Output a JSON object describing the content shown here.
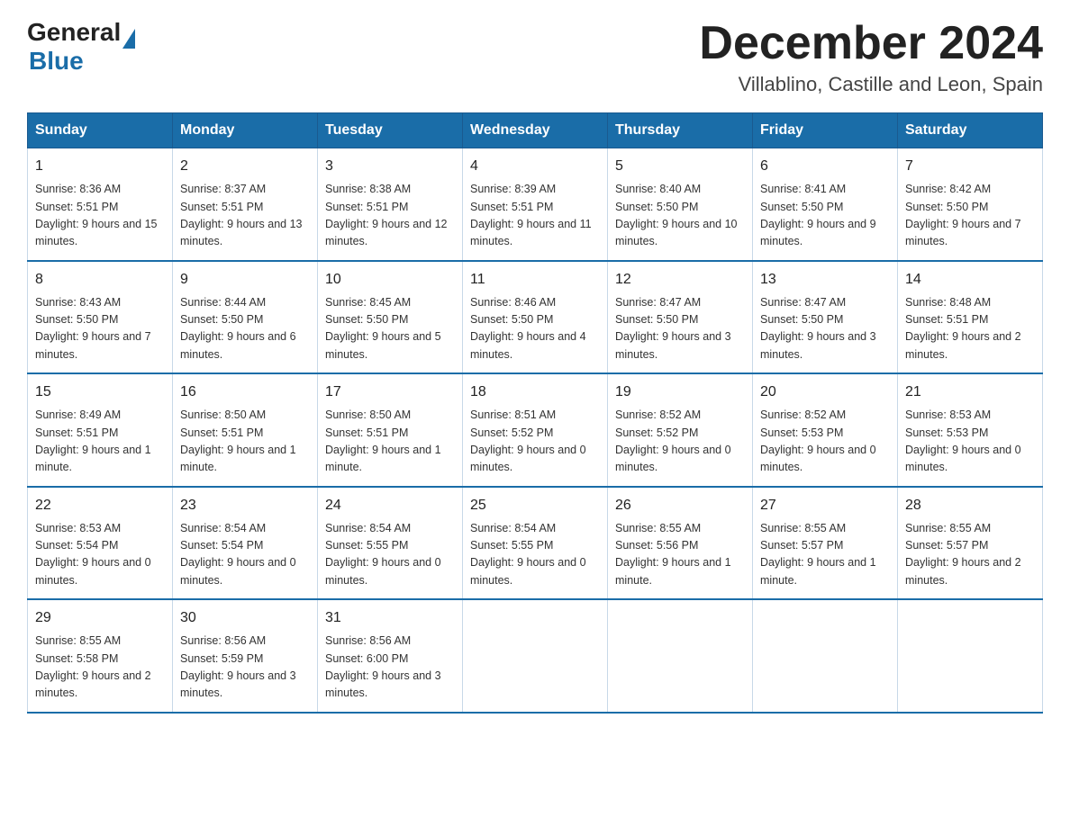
{
  "header": {
    "logo_general": "General",
    "logo_blue": "Blue",
    "title": "December 2024",
    "subtitle": "Villablino, Castille and Leon, Spain"
  },
  "calendar": {
    "days_of_week": [
      "Sunday",
      "Monday",
      "Tuesday",
      "Wednesday",
      "Thursday",
      "Friday",
      "Saturday"
    ],
    "weeks": [
      [
        {
          "day": "1",
          "sunrise": "8:36 AM",
          "sunset": "5:51 PM",
          "daylight": "9 hours and 15 minutes."
        },
        {
          "day": "2",
          "sunrise": "8:37 AM",
          "sunset": "5:51 PM",
          "daylight": "9 hours and 13 minutes."
        },
        {
          "day": "3",
          "sunrise": "8:38 AM",
          "sunset": "5:51 PM",
          "daylight": "9 hours and 12 minutes."
        },
        {
          "day": "4",
          "sunrise": "8:39 AM",
          "sunset": "5:51 PM",
          "daylight": "9 hours and 11 minutes."
        },
        {
          "day": "5",
          "sunrise": "8:40 AM",
          "sunset": "5:50 PM",
          "daylight": "9 hours and 10 minutes."
        },
        {
          "day": "6",
          "sunrise": "8:41 AM",
          "sunset": "5:50 PM",
          "daylight": "9 hours and 9 minutes."
        },
        {
          "day": "7",
          "sunrise": "8:42 AM",
          "sunset": "5:50 PM",
          "daylight": "9 hours and 7 minutes."
        }
      ],
      [
        {
          "day": "8",
          "sunrise": "8:43 AM",
          "sunset": "5:50 PM",
          "daylight": "9 hours and 7 minutes."
        },
        {
          "day": "9",
          "sunrise": "8:44 AM",
          "sunset": "5:50 PM",
          "daylight": "9 hours and 6 minutes."
        },
        {
          "day": "10",
          "sunrise": "8:45 AM",
          "sunset": "5:50 PM",
          "daylight": "9 hours and 5 minutes."
        },
        {
          "day": "11",
          "sunrise": "8:46 AM",
          "sunset": "5:50 PM",
          "daylight": "9 hours and 4 minutes."
        },
        {
          "day": "12",
          "sunrise": "8:47 AM",
          "sunset": "5:50 PM",
          "daylight": "9 hours and 3 minutes."
        },
        {
          "day": "13",
          "sunrise": "8:47 AM",
          "sunset": "5:50 PM",
          "daylight": "9 hours and 3 minutes."
        },
        {
          "day": "14",
          "sunrise": "8:48 AM",
          "sunset": "5:51 PM",
          "daylight": "9 hours and 2 minutes."
        }
      ],
      [
        {
          "day": "15",
          "sunrise": "8:49 AM",
          "sunset": "5:51 PM",
          "daylight": "9 hours and 1 minute."
        },
        {
          "day": "16",
          "sunrise": "8:50 AM",
          "sunset": "5:51 PM",
          "daylight": "9 hours and 1 minute."
        },
        {
          "day": "17",
          "sunrise": "8:50 AM",
          "sunset": "5:51 PM",
          "daylight": "9 hours and 1 minute."
        },
        {
          "day": "18",
          "sunrise": "8:51 AM",
          "sunset": "5:52 PM",
          "daylight": "9 hours and 0 minutes."
        },
        {
          "day": "19",
          "sunrise": "8:52 AM",
          "sunset": "5:52 PM",
          "daylight": "9 hours and 0 minutes."
        },
        {
          "day": "20",
          "sunrise": "8:52 AM",
          "sunset": "5:53 PM",
          "daylight": "9 hours and 0 minutes."
        },
        {
          "day": "21",
          "sunrise": "8:53 AM",
          "sunset": "5:53 PM",
          "daylight": "9 hours and 0 minutes."
        }
      ],
      [
        {
          "day": "22",
          "sunrise": "8:53 AM",
          "sunset": "5:54 PM",
          "daylight": "9 hours and 0 minutes."
        },
        {
          "day": "23",
          "sunrise": "8:54 AM",
          "sunset": "5:54 PM",
          "daylight": "9 hours and 0 minutes."
        },
        {
          "day": "24",
          "sunrise": "8:54 AM",
          "sunset": "5:55 PM",
          "daylight": "9 hours and 0 minutes."
        },
        {
          "day": "25",
          "sunrise": "8:54 AM",
          "sunset": "5:55 PM",
          "daylight": "9 hours and 0 minutes."
        },
        {
          "day": "26",
          "sunrise": "8:55 AM",
          "sunset": "5:56 PM",
          "daylight": "9 hours and 1 minute."
        },
        {
          "day": "27",
          "sunrise": "8:55 AM",
          "sunset": "5:57 PM",
          "daylight": "9 hours and 1 minute."
        },
        {
          "day": "28",
          "sunrise": "8:55 AM",
          "sunset": "5:57 PM",
          "daylight": "9 hours and 2 minutes."
        }
      ],
      [
        {
          "day": "29",
          "sunrise": "8:55 AM",
          "sunset": "5:58 PM",
          "daylight": "9 hours and 2 minutes."
        },
        {
          "day": "30",
          "sunrise": "8:56 AM",
          "sunset": "5:59 PM",
          "daylight": "9 hours and 3 minutes."
        },
        {
          "day": "31",
          "sunrise": "8:56 AM",
          "sunset": "6:00 PM",
          "daylight": "9 hours and 3 minutes."
        },
        null,
        null,
        null,
        null
      ]
    ]
  }
}
